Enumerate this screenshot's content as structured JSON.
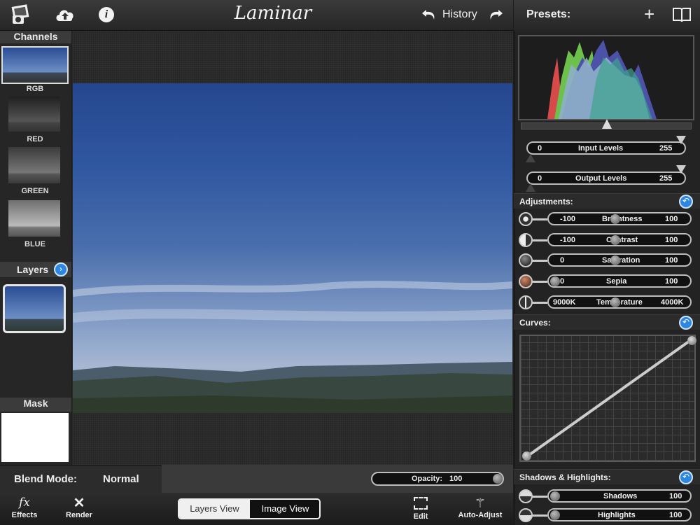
{
  "app": {
    "logo": "Laminar"
  },
  "toolbar": {
    "history_label": "History",
    "icons": [
      "photo-library-icon",
      "cloud-upload-icon",
      "info-icon",
      "undo-icon",
      "redo-icon"
    ]
  },
  "left": {
    "channels_title": "Channels",
    "channels": [
      "RGB",
      "RED",
      "GREEN",
      "BLUE"
    ],
    "layers_title": "Layers",
    "mask_title": "Mask"
  },
  "blend": {
    "label": "Blend Mode:",
    "value": "Normal",
    "opacity_label": "Opacity:",
    "opacity_value": "100",
    "opacity_fraction": 1.0
  },
  "bottom": {
    "effects": "Effects",
    "render": "Render",
    "layers_view": "Layers View",
    "image_view": "Image View",
    "edit": "Edit",
    "auto_adjust": "Auto-Adjust"
  },
  "right": {
    "presets_title": "Presets:",
    "levels": {
      "input": {
        "label": "Input Levels",
        "min": "0",
        "max": "255"
      },
      "output": {
        "label": "Output Levels",
        "min": "0",
        "max": "255"
      }
    },
    "adjustments_title": "Adjustments:",
    "adjustments": [
      {
        "label": "Brightness",
        "min": "-100",
        "max": "100",
        "level": 0.5
      },
      {
        "label": "Contrast",
        "min": "-100",
        "max": "100",
        "level": 0.5
      },
      {
        "label": "Saturation",
        "min": "0",
        "max": "100",
        "level": 0.5
      },
      {
        "label": "Sepia",
        "min": "0",
        "max": "100",
        "level": 0.0
      },
      {
        "label": "Temperature",
        "min": "9000K",
        "max": "4000K",
        "level": 0.5
      }
    ],
    "curves_title": "Curves:",
    "shadows_title": "Shadows & Highlights:",
    "shadows": [
      {
        "label": "Shadows",
        "min": "0",
        "max": "100",
        "level": 0.0
      },
      {
        "label": "Highlights",
        "min": "0",
        "max": "100",
        "level": 0.0
      }
    ]
  },
  "colors": {
    "accent": "#2d87e0",
    "sky_top": "#2d4f96",
    "sky_bottom": "#9fb2cf"
  }
}
